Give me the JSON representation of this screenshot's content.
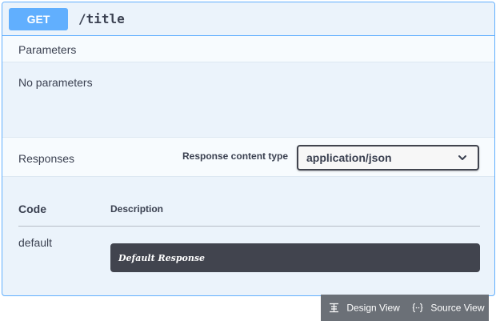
{
  "operation": {
    "method": "GET",
    "path": "/title"
  },
  "parameters": {
    "header": "Parameters",
    "empty_text": "No parameters"
  },
  "responses": {
    "header": "Responses",
    "content_type_label": "Response content type",
    "content_type_value": "application/json",
    "columns": {
      "code": "Code",
      "description": "Description"
    },
    "rows": [
      {
        "code": "default",
        "description": "Default Response"
      }
    ]
  },
  "view_toggle": {
    "design_label": "Design View",
    "source_label": "Source View"
  },
  "colors": {
    "method_get": "#61affe",
    "block_bg": "#ebf3fb",
    "description_bg": "#41444e",
    "view_bar_bg": "#6b7077"
  }
}
